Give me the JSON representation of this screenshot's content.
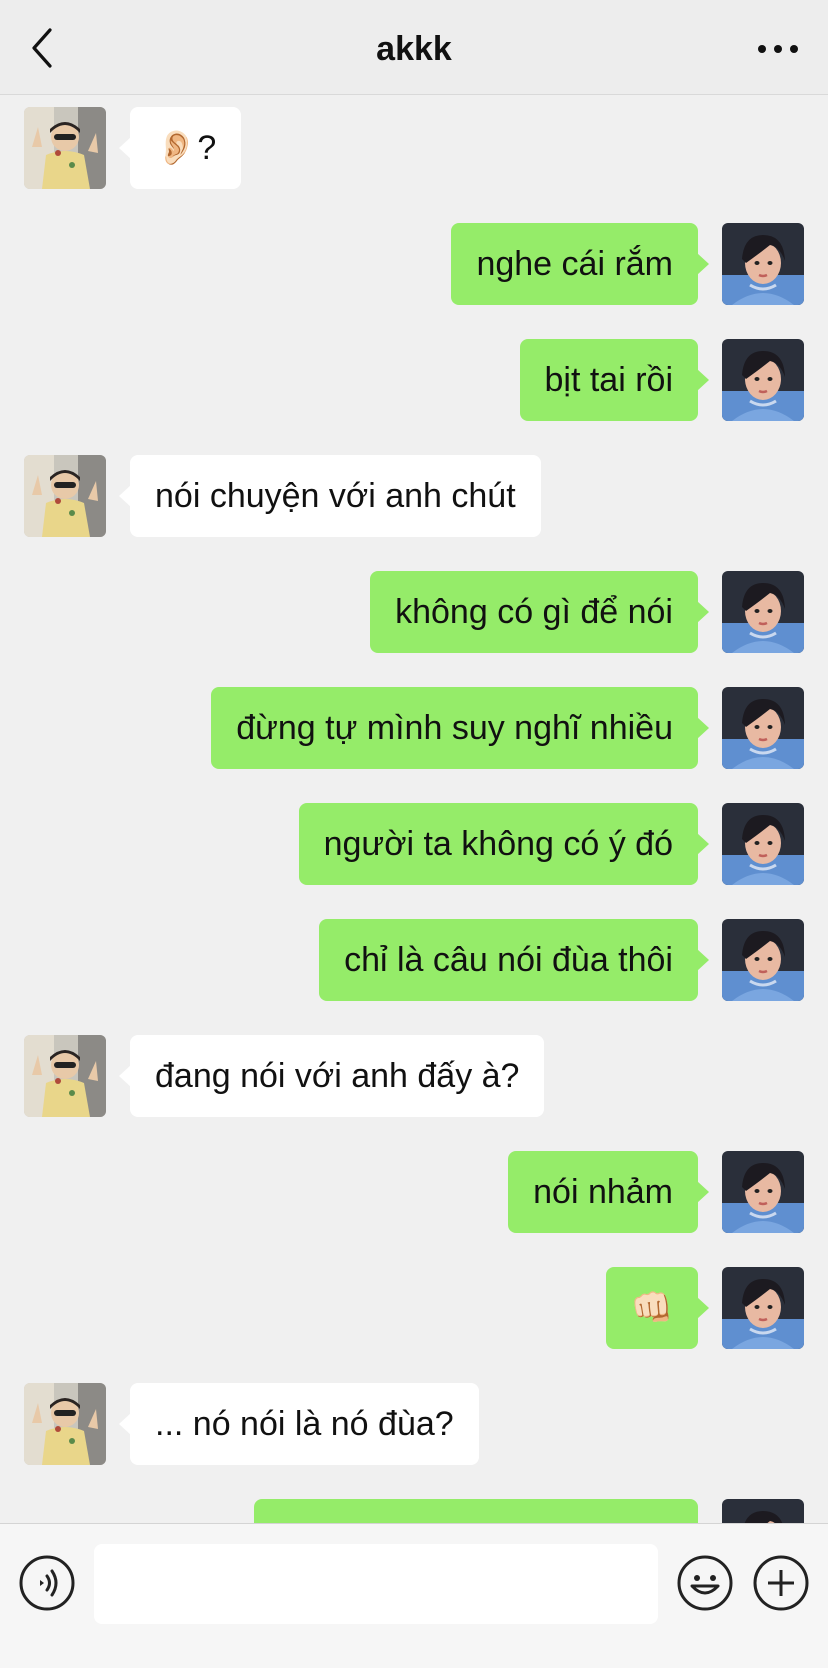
{
  "header": {
    "title": "akkk",
    "back_icon": "chevron-left-icon",
    "more_icon": "more-horizontal-icon"
  },
  "messages": [
    {
      "side": "in",
      "text": "👂🏻?"
    },
    {
      "side": "out",
      "text": "nghe cái rắm"
    },
    {
      "side": "out",
      "text": "bịt tai rồi"
    },
    {
      "side": "in",
      "text": "nói chuyện với anh chút"
    },
    {
      "side": "out",
      "text": "không có gì để nói"
    },
    {
      "side": "out",
      "text": "đừng tự mình suy nghĩ nhiều"
    },
    {
      "side": "out",
      "text": "người ta không có ý đó"
    },
    {
      "side": "out",
      "text": "chỉ là câu nói đùa thôi"
    },
    {
      "side": "in",
      "text": "đang nói với anh đấy à?"
    },
    {
      "side": "out",
      "text": "nói nhảm"
    },
    {
      "side": "out",
      "text": "👊🏻"
    },
    {
      "side": "in",
      "text": "... nó nói là nó đùa?"
    },
    {
      "side": "out",
      "text": ""
    }
  ],
  "composer": {
    "input_value": "",
    "voice_icon": "voice-input-icon",
    "emoji_icon": "emoji-smile-icon",
    "plus_icon": "plus-circle-icon"
  },
  "colors": {
    "outgoing_bubble": "#95ec69",
    "incoming_bubble": "#ffffff",
    "background": "#f0f0f0"
  }
}
